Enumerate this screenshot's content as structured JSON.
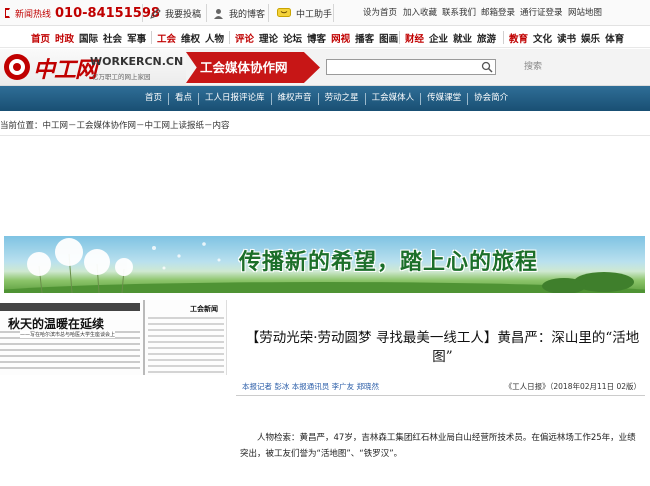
{
  "topbar": {
    "hotline_label": "新闻热线",
    "hotline_number": "010-84151598",
    "submit_label": "我要投稿",
    "blog_label": "我的博客",
    "assistant_label": "中工助手",
    "links": [
      "设为首页",
      "加入收藏",
      "联系我们",
      "邮箱登录",
      "通行证登录",
      "网站地图"
    ]
  },
  "category_nav": {
    "group1": [
      "首页",
      "时政",
      "国际",
      "社会",
      "军事"
    ],
    "group2": [
      "工会",
      "维权",
      "人物"
    ],
    "group3": [
      "评论",
      "理论",
      "论坛",
      "博客",
      "网视",
      "播客",
      "图画"
    ],
    "group4": [
      "财经",
      "企业",
      "就业",
      "旅游"
    ],
    "group5": [
      "教育",
      "文化",
      "读书",
      "娱乐",
      "体育"
    ]
  },
  "header": {
    "logo_cn": "中工网",
    "logo_en": "WORKERCN.CN",
    "logo_tagline": "亿万职工的网上家园",
    "section_title": "工会媒体协作网",
    "search_placeholder": "",
    "search_button": "搜索"
  },
  "main_nav": [
    "首页",
    "看点",
    "工人日报评论库",
    "维权声音",
    "劳动之星",
    "工会媒体人",
    "传媒课堂",
    "协会简介"
  ],
  "breadcrumb": "当前位置：中工网－工会媒体协作网－中工网上读报纸－内容",
  "banner_text": "传播新的希望，踏上心的旅程",
  "paper_thumb": {
    "headline": "秋天的温暖在延续",
    "subline": "——写在哈尔滨市总与哈医大学生座谈会上",
    "masthead": "工会新闻"
  },
  "article": {
    "title": "【劳动光荣·劳动圆梦 寻找最美一线工人】黄昌严：深山里的“活地图”",
    "byline": "本报记者 彭冰 本报通讯员 李广友 郑晓然",
    "source": "《工人日报》（2018年02月11日 02版）",
    "para1": "人物检索：黄昌严，47岁，吉林森工集团红石林业局白山经营所技术员。在偏远林场工作25年，业绩突出，被工友们誉为“活地图”、“铁罗汉”。",
    "para2": ""
  },
  "colors": {
    "brand_red": "#c00000",
    "nav_blue": "#1f5a82",
    "link_blue": "#2a5da8"
  }
}
